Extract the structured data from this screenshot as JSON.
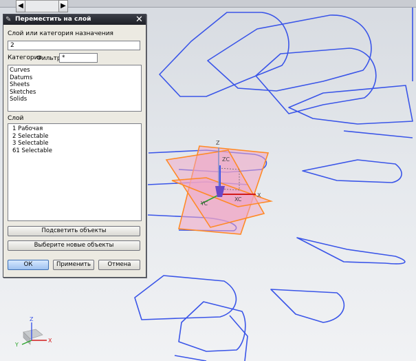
{
  "dialog": {
    "title": "Переместить на слой",
    "target_label": "Слой или категория назначения",
    "target_value": "2",
    "category_label": "Категория",
    "filter_label": "Фильтр",
    "filter_value": "*",
    "categories": [
      "Curves",
      "Datums",
      "Sheets",
      "Sketches",
      "Solids"
    ],
    "layer_label": "Слой",
    "layers": [
      "1 Рабочая",
      "2 Selectable",
      "3 Selectable",
      "61 Selectable"
    ],
    "highlight_button": "Подсветить объекты",
    "select_new_button": "Выберите новые объекты",
    "ok_button": "ОК",
    "apply_button": "Применить",
    "cancel_button": "Отмена"
  },
  "scrollbar": {
    "left_arrow": "◀",
    "right_arrow": "▶"
  },
  "viewport": {
    "wcs_labels": {
      "z": "Z",
      "zc": "ZC",
      "x": "X",
      "xc": "XC",
      "yc": "YC"
    },
    "triad_labels": {
      "z": "Z",
      "y": "Y",
      "x": "X"
    }
  },
  "colors": {
    "curves": "#3a55e8",
    "datum_fill": "#f0a4c4",
    "datum_edge": "#ff8a26",
    "title_bar": "#2a2c33"
  }
}
